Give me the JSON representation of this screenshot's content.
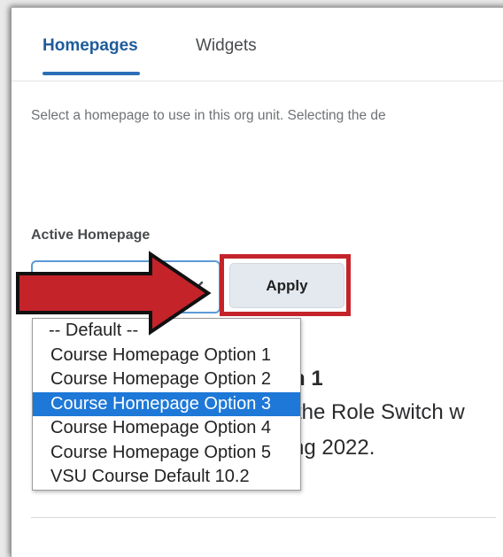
{
  "tabs": [
    {
      "label": "Homepages",
      "active": true
    },
    {
      "label": "Widgets",
      "active": false
    }
  ],
  "description": "Select a homepage to use in this org unit. Selecting the de",
  "active_homepage": {
    "label": "Active Homepage",
    "options": [
      "-- Default --",
      "Course Homepage Option 1",
      "Course Homepage Option 2",
      "Course Homepage Option 3",
      "Course Homepage Option 4",
      "Course Homepage Option 5",
      "VSU Course Default 10.2"
    ],
    "highlighted_option": "Course Homepage Option 3"
  },
  "apply_label": "Apply",
  "background_text": {
    "heading_fragment": "n 1",
    "line1_fragment": "the Role Switch w",
    "line2_fragment": "ng 2022."
  },
  "colors": {
    "accent": "#2b6fb6",
    "annotation_red": "#c4232a",
    "selected_option_bg": "#1e78d7"
  },
  "icons": {
    "select_chevron": "chevron-down-icon",
    "annotation": "arrow-right-icon"
  }
}
